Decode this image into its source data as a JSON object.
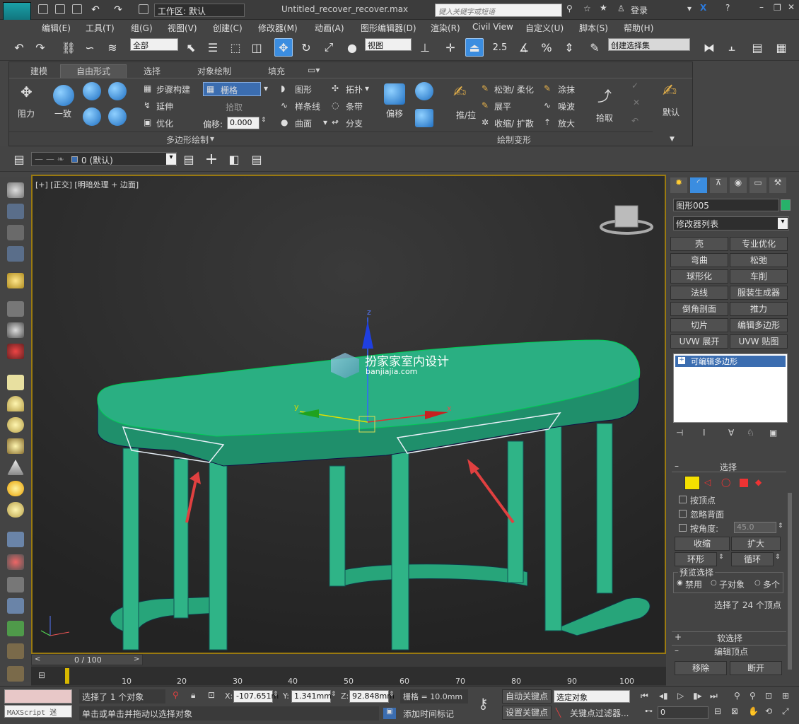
{
  "titlebar": {
    "logo": "MAX",
    "workspace": "工作区: 默认",
    "window_title": "Untitled_recover_recover.max",
    "search_placeholder": "键入关键字或短语",
    "login": "登录"
  },
  "menus": [
    "编辑(E)",
    "工具(T)",
    "组(G)",
    "视图(V)",
    "创建(C)",
    "修改器(M)",
    "动画(A)",
    "图形编辑器(D)",
    "渲染(R)",
    "Civil View",
    "自定义(U)",
    "脚本(S)",
    "帮助(H)"
  ],
  "toolbar": {
    "filter": "全部",
    "coord": "视图",
    "selset": "创建选择集",
    "snap_label": "2.5"
  },
  "ribbon": {
    "tabs": [
      "建模",
      "自由形式",
      "选择",
      "对象绘制",
      "填充"
    ],
    "active_tab": "自由形式",
    "resistance": "阻力",
    "consistent": "一致",
    "step_build": "步骤构建",
    "extend": "延伸",
    "optimize": "优化",
    "grid_label": "栅格",
    "pickup": "拾取",
    "offset_label": "偏移:",
    "offset_value": "0.000",
    "shape": "图形",
    "spline": "样条线",
    "surface": "曲面",
    "topology": "拓扑",
    "strip": "条带",
    "branch": "分支",
    "offset_btn": "偏移",
    "pushpull": "推/拉",
    "relax": "松弛/ 柔化",
    "flatten": "展平",
    "shrink": "收缩/ 扩散",
    "paint": "涂抹",
    "noise": "噪波",
    "amplify": "放大",
    "pick": "拾取",
    "default": "默认",
    "sec_poly": "多边形绘制",
    "sec_deform": "绘制变形"
  },
  "layer": {
    "name": "0 (默认)"
  },
  "viewport": {
    "label": "[+] [正交] [明暗处理 + 边面]",
    "watermark_title": "扮家家室内设计",
    "watermark_url": "banjiajia.com",
    "axis_z": "z",
    "axis_x": "x",
    "axis_y": "y"
  },
  "cmdpanel": {
    "object_name": "图形005",
    "object_color": "#27b26a",
    "modifier_list": "修改器列表",
    "modifiers": [
      "壳",
      "专业优化",
      "弯曲",
      "松弛",
      "球形化",
      "车削",
      "法线",
      "服装生成器",
      "倒角剖面",
      "推力",
      "切片",
      "编辑多边形",
      "UVW 展开",
      "UVW 贴图"
    ],
    "stack_item": "可编辑多边形",
    "rollout_select": "选择",
    "by_vertex": "按顶点",
    "ignore_back": "忽略背面",
    "by_angle": "按角度:",
    "angle_value": "45.0",
    "shrink": "收缩",
    "grow": "扩大",
    "ring": "环形",
    "loop": "循环",
    "preview": "预览选择",
    "disable": "禁用",
    "subobj": "子对象",
    "multi": "多个",
    "selected_info": "选择了 24 个顶点",
    "soft_select": "软选择",
    "edit_vertices": "编辑顶点",
    "move": "移除",
    "break": "断开"
  },
  "timeline": {
    "frame": "0 / 100",
    "ticks": [
      "10",
      "20",
      "30",
      "40",
      "50",
      "60",
      "70",
      "80",
      "90",
      "100"
    ]
  },
  "status": {
    "maxscript": "MAXScript 迷",
    "selected": "选择了 1 个对象",
    "prompt": "单击或单击并拖动以选择对象",
    "x_label": "X:",
    "x": "-107.651m",
    "y_label": "Y:",
    "y": "1.341mm",
    "z_label": "Z:",
    "z": "92.848mm",
    "grid": "栅格 = 10.0mm",
    "add_tag": "添加时间标记",
    "auto_key": "自动关键点",
    "set_key": "设置关键点",
    "key_mode": "选定对象",
    "key_filter": "关键点过滤器...",
    "frame_field": "0"
  },
  "colors": {
    "viewport_border": "#9a7a10",
    "table_green": "#27a57a",
    "accent_blue": "#3b8de0"
  }
}
